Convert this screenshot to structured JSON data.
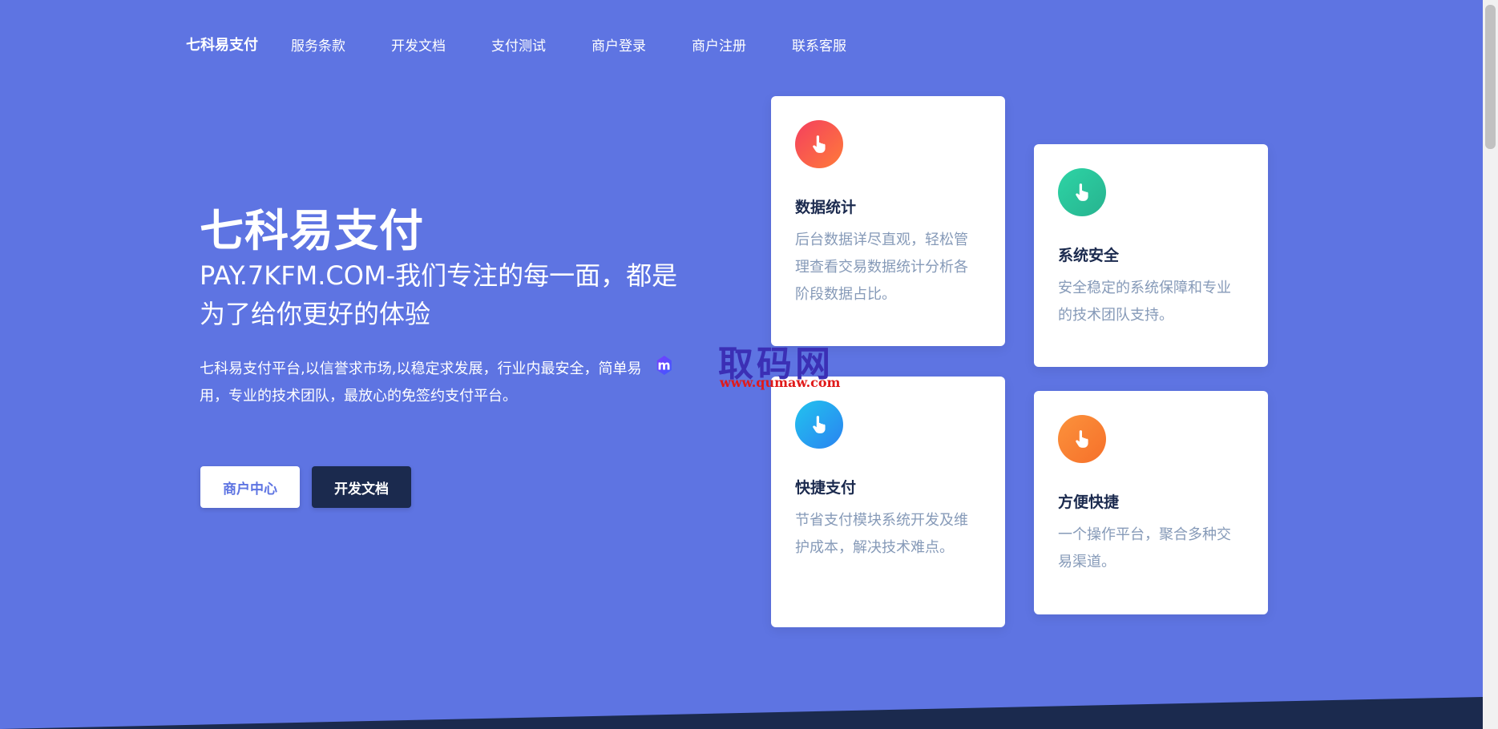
{
  "nav": {
    "brand": "七科易支付",
    "links": [
      "服务条款",
      "开发文档",
      "支付测试",
      "商户登录",
      "商户注册",
      "联系客服"
    ]
  },
  "hero": {
    "title": "七科易支付",
    "subtitle": "PAY.7KFM.COM-我们专注的每一面，都是为了给你更好的体验",
    "description": "七科易支付平台,以信誉求市场,以稳定求发展，行业内最安全，简单易用，专业的技术团队，最放心的免签约支付平台。",
    "buttons": {
      "merchant_center": "商户中心",
      "dev_docs": "开发文档"
    }
  },
  "features": [
    {
      "title": "数据统计",
      "text": "后台数据详尽直观，轻松管理查看交易数据统计分析各阶段数据占比。",
      "icon": "hand-pointer-icon",
      "color": "#f43f5e"
    },
    {
      "title": "系统安全",
      "text": "安全稳定的系统保障和专业的技术团队支持。",
      "icon": "hand-pointer-icon",
      "color": "#2dd4a5"
    },
    {
      "title": "快捷支付",
      "text": "节省支付模块系统开发及维护成本，解决技术难点。",
      "icon": "hand-pointer-icon",
      "color": "#2a9df4"
    },
    {
      "title": "方便快捷",
      "text": "一个操作平台，聚合多种交易渠道。",
      "icon": "hand-pointer-icon",
      "color": "#fb923c"
    }
  ],
  "watermark": {
    "text": "取码网",
    "url": "www.qumaw.com"
  },
  "colors": {
    "background": "#5e74e2",
    "dark": "#1b2a4e",
    "card_text": "#869ab8"
  }
}
